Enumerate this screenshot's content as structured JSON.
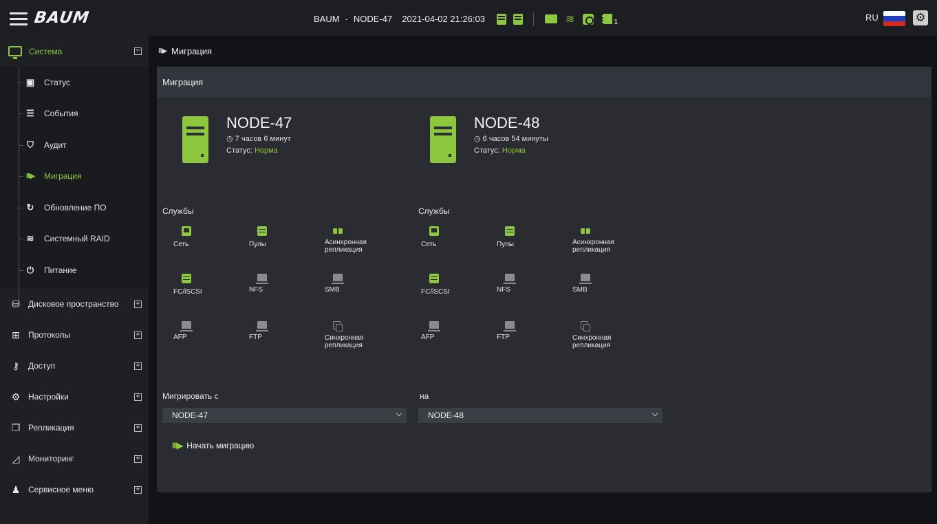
{
  "header": {
    "logo": "BAUM",
    "brand": "BAUM",
    "separator": "-",
    "node": "NODE-47",
    "datetime": "2021-04-02 21:26:03",
    "chip_count": "1",
    "language": "RU",
    "accent_color": "#8dc63f"
  },
  "sidebar": {
    "system": {
      "label": "Система",
      "toggle": "−"
    },
    "system_items": [
      {
        "label": "Статус",
        "icon": "status-icon"
      },
      {
        "label": "События",
        "icon": "events-icon"
      },
      {
        "label": "Аудит",
        "icon": "shield-icon"
      },
      {
        "label": "Миграция",
        "icon": "migration-icon",
        "active": true
      },
      {
        "label": "Обновление ПО",
        "icon": "refresh-icon"
      },
      {
        "label": "Системный RAID",
        "icon": "layers-icon"
      },
      {
        "label": "Питание",
        "icon": "power-icon"
      }
    ],
    "sections": [
      {
        "label": "Дисковое пространство",
        "icon": "database-icon",
        "toggle": "+"
      },
      {
        "label": "Протоколы",
        "icon": "network-icon",
        "toggle": "+"
      },
      {
        "label": "Доступ",
        "icon": "key-icon",
        "toggle": "+"
      },
      {
        "label": "Настройки",
        "icon": "gear-icon",
        "toggle": "+"
      },
      {
        "label": "Репликация",
        "icon": "copy-icon",
        "toggle": "+"
      },
      {
        "label": "Мониторинг",
        "icon": "chart-icon",
        "toggle": "+"
      },
      {
        "label": "Сервисное меню",
        "icon": "service-user-icon",
        "toggle": "+"
      }
    ]
  },
  "breadcrumb": {
    "label": "Миграция"
  },
  "panel": {
    "title": "Миграция",
    "nodes": [
      {
        "name": "NODE-47",
        "uptime": "7 часов 6 минут",
        "status_label": "Статус:",
        "status_value": "Норма",
        "services_title": "Службы",
        "services": [
          {
            "label": "Сеть",
            "state": "on",
            "kind": "net"
          },
          {
            "label": "Пулы",
            "state": "on",
            "kind": "pool"
          },
          {
            "label": "Асинхронная репликация",
            "state": "on",
            "kind": "async"
          },
          {
            "label": "FC/iSCSI",
            "state": "on",
            "kind": "fc"
          },
          {
            "label": "NFS",
            "state": "off",
            "kind": "share"
          },
          {
            "label": "SMB",
            "state": "off",
            "kind": "share"
          },
          {
            "label": "AFP",
            "state": "off",
            "kind": "share"
          },
          {
            "label": "FTP",
            "state": "off",
            "kind": "share"
          },
          {
            "label": "Синхронная репликация",
            "state": "off",
            "kind": "sync"
          }
        ]
      },
      {
        "name": "NODE-48",
        "uptime": "6 часов 54 минуты",
        "status_label": "Статус:",
        "status_value": "Норма",
        "services_title": "Службы",
        "services": [
          {
            "label": "Сеть",
            "state": "on",
            "kind": "net"
          },
          {
            "label": "Пулы",
            "state": "on",
            "kind": "pool"
          },
          {
            "label": "Асинхронная репликация",
            "state": "on",
            "kind": "async"
          },
          {
            "label": "FC/iSCSI",
            "state": "on",
            "kind": "fc"
          },
          {
            "label": "NFS",
            "state": "off",
            "kind": "share"
          },
          {
            "label": "SMB",
            "state": "off",
            "kind": "share"
          },
          {
            "label": "AFP",
            "state": "off",
            "kind": "share"
          },
          {
            "label": "FTP",
            "state": "off",
            "kind": "share"
          },
          {
            "label": "Синхронная репликация",
            "state": "off",
            "kind": "sync"
          }
        ]
      }
    ],
    "migrate_from_label": "Мигрировать с",
    "migrate_to_label": "на",
    "from_value": "NODE-47",
    "to_value": "NODE-48",
    "start_button": "Начать миграцию"
  }
}
